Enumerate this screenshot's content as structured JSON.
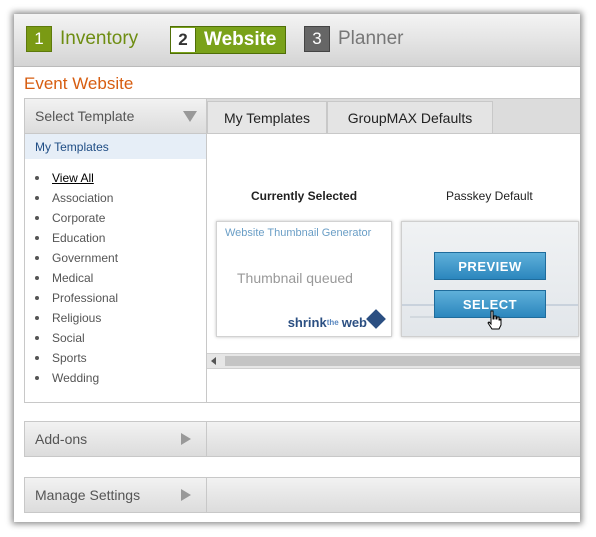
{
  "steps": [
    {
      "num": "1",
      "label": "Inventory"
    },
    {
      "num": "2",
      "label": "Website"
    },
    {
      "num": "3",
      "label": "Planner"
    }
  ],
  "page_title": "Event Website",
  "template_panel": {
    "header": "Select Template",
    "sub_header": "My Templates",
    "categories": [
      "View All",
      "Association",
      "Corporate",
      "Education",
      "Government",
      "Medical",
      "Professional",
      "Religious",
      "Social",
      "Sports",
      "Wedding"
    ]
  },
  "tabs": [
    "My Templates",
    "GroupMAX Defaults"
  ],
  "templates": {
    "current_label": "Currently Selected",
    "default_label": "Passkey Default",
    "thumb_generator": "Website Thumbnail Generator",
    "thumb_status": "Thumbnail queued",
    "thumb_logo_a": "shrink",
    "thumb_logo_b": "the",
    "thumb_logo_c": "web",
    "preview_button": "PREVIEW",
    "select_button": "SELECT"
  },
  "sections": [
    "Add-ons",
    "Manage Settings"
  ],
  "colors": {
    "accent_green": "#7aa21a",
    "title_orange": "#d75d10",
    "button_blue": "#2b86bd"
  }
}
